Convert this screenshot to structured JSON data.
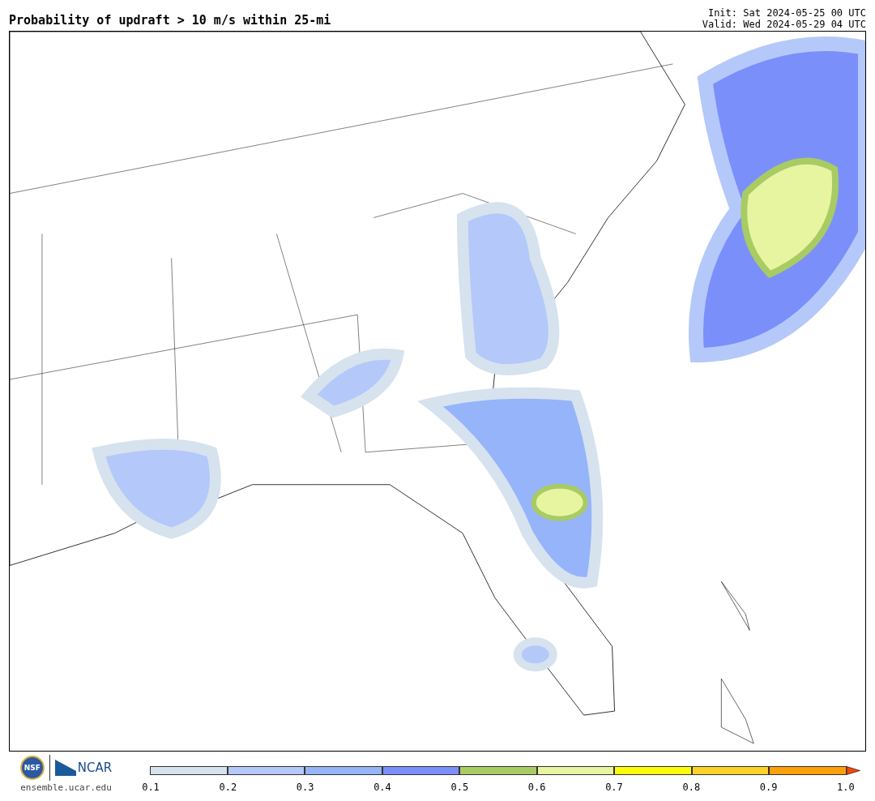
{
  "header": {
    "title": "Probability of updraft > 10 m/s within 25-mi",
    "init": "Init: Sat 2024-05-25 00 UTC",
    "valid": "Valid: Wed 2024-05-29 04 UTC"
  },
  "footer": {
    "nsf": "NSF",
    "ncar": "NCAR",
    "site": "ensemble.ucar.edu"
  },
  "colorbar": {
    "bins": [
      {
        "color": "#d6e2ee"
      },
      {
        "color": "#b4c8fa"
      },
      {
        "color": "#96b4fa"
      },
      {
        "color": "#7b8ffa"
      },
      {
        "color": "#a8cb64"
      },
      {
        "color": "#e8f5a0"
      },
      {
        "color": "#fcfc0a"
      },
      {
        "color": "#fcd228"
      },
      {
        "color": "#fca00a"
      },
      {
        "color": "#ee4a0a",
        "kind": "extend"
      }
    ],
    "ticks": [
      "0.1",
      "0.2",
      "0.3",
      "0.4",
      "0.5",
      "0.6",
      "0.7",
      "0.8",
      "0.9",
      "1.0"
    ]
  }
}
